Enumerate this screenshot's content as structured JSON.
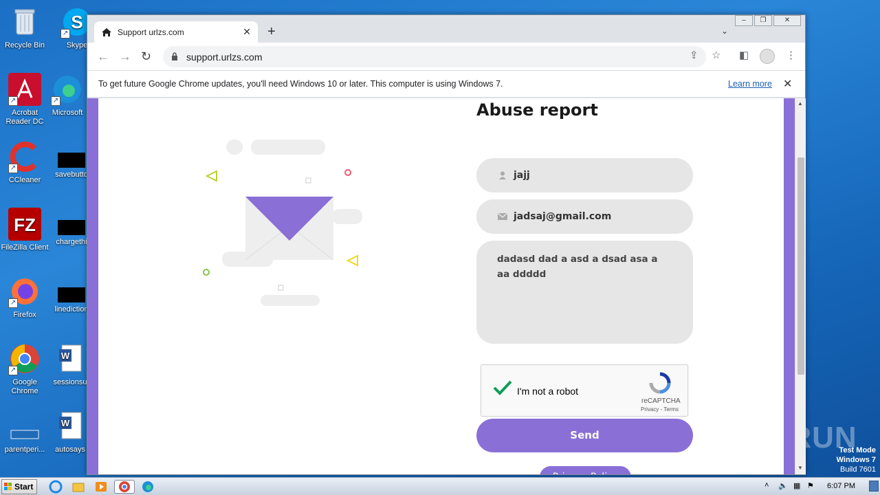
{
  "desktop": {
    "icons": [
      {
        "label": "Recycle Bin"
      },
      {
        "label": "Skype"
      },
      {
        "label": "Acrobat Reader DC"
      },
      {
        "label": "Microsoft"
      },
      {
        "label": "CCleaner"
      },
      {
        "label": "savebutto"
      },
      {
        "label": "FileZilla Client"
      },
      {
        "label": "chargethi"
      },
      {
        "label": "Firefox"
      },
      {
        "label": "linediction"
      },
      {
        "label": "Google Chrome"
      },
      {
        "label": "sessionsu"
      },
      {
        "label": "parentperi..."
      },
      {
        "label": "autosays"
      }
    ],
    "watermark": "ANY RUN",
    "test_mode": {
      "line1": "Test Mode",
      "line2": "Windows 7",
      "line3": "Build 7601"
    }
  },
  "browser": {
    "tab_title": "Support urlzs.com",
    "url": "support.urlzs.com",
    "infobar_text": "To get future Google Chrome updates, you'll need Windows 10 or later. This computer is using Windows 7.",
    "infobar_link": "Learn more"
  },
  "page": {
    "heading": "Abuse report",
    "name_value": "jajj",
    "email_value": "jadsaj@gmail.com",
    "message_value": "dadasd  dad a asd a dsad asa a aa   ddddd",
    "recaptcha": {
      "label": "I'm not a robot",
      "brand": "reCAPTCHA",
      "terms": "Privacy - Terms"
    },
    "send_label": "Send",
    "privacy_label": "Privacy Policy",
    "accent_color": "#8a6fd6"
  },
  "taskbar": {
    "start_label": "Start",
    "clock": "6:07 PM"
  }
}
